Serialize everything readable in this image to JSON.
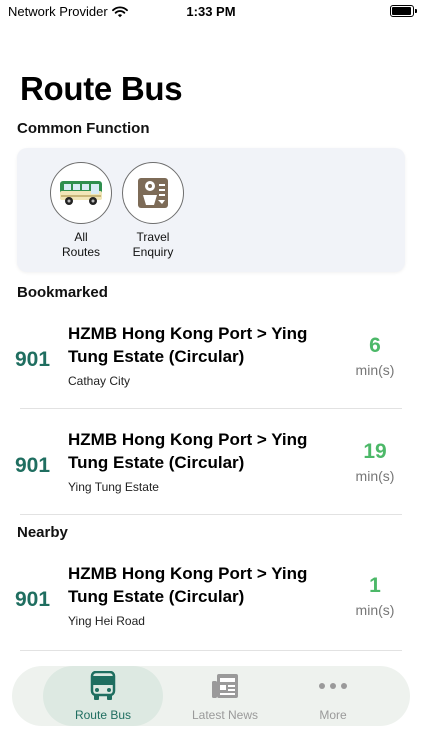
{
  "status_bar": {
    "carrier": "Network Provider",
    "time": "1:33 PM",
    "battery_level": 0.95
  },
  "page": {
    "title": "Route Bus"
  },
  "common_function": {
    "heading": "Common Function",
    "items": [
      {
        "label": "All\nRoutes",
        "icon": "minibus-icon"
      },
      {
        "label": "Travel\nEnquiry",
        "icon": "travel-enquiry-icon"
      }
    ]
  },
  "bookmarked": {
    "heading": "Bookmarked",
    "routes": [
      {
        "number": "901",
        "destination": "HZMB Hong Kong Port > Ying Tung Estate (Circular)",
        "stop": "Cathay City",
        "eta": "6",
        "unit": "min(s)"
      },
      {
        "number": "901",
        "destination": "HZMB Hong Kong Port > Ying Tung Estate (Circular)",
        "stop": "Ying Tung Estate",
        "eta": "19",
        "unit": "min(s)"
      }
    ]
  },
  "nearby": {
    "heading": "Nearby",
    "routes": [
      {
        "number": "901",
        "destination": "HZMB Hong Kong Port > Ying Tung Estate (Circular)",
        "stop": "Ying Hei Road",
        "eta": "1",
        "unit": "min(s)"
      }
    ]
  },
  "tab_bar": {
    "tabs": [
      {
        "label": "Route Bus",
        "icon": "bus-icon",
        "active": true
      },
      {
        "label": "Latest News",
        "icon": "newspaper-icon",
        "active": false
      },
      {
        "label": "More",
        "icon": "more-icon",
        "active": false
      }
    ]
  },
  "colors": {
    "accent": "#1f6e60",
    "eta_green": "#4cb868",
    "tab_bar_bg": "#eef2ee"
  }
}
